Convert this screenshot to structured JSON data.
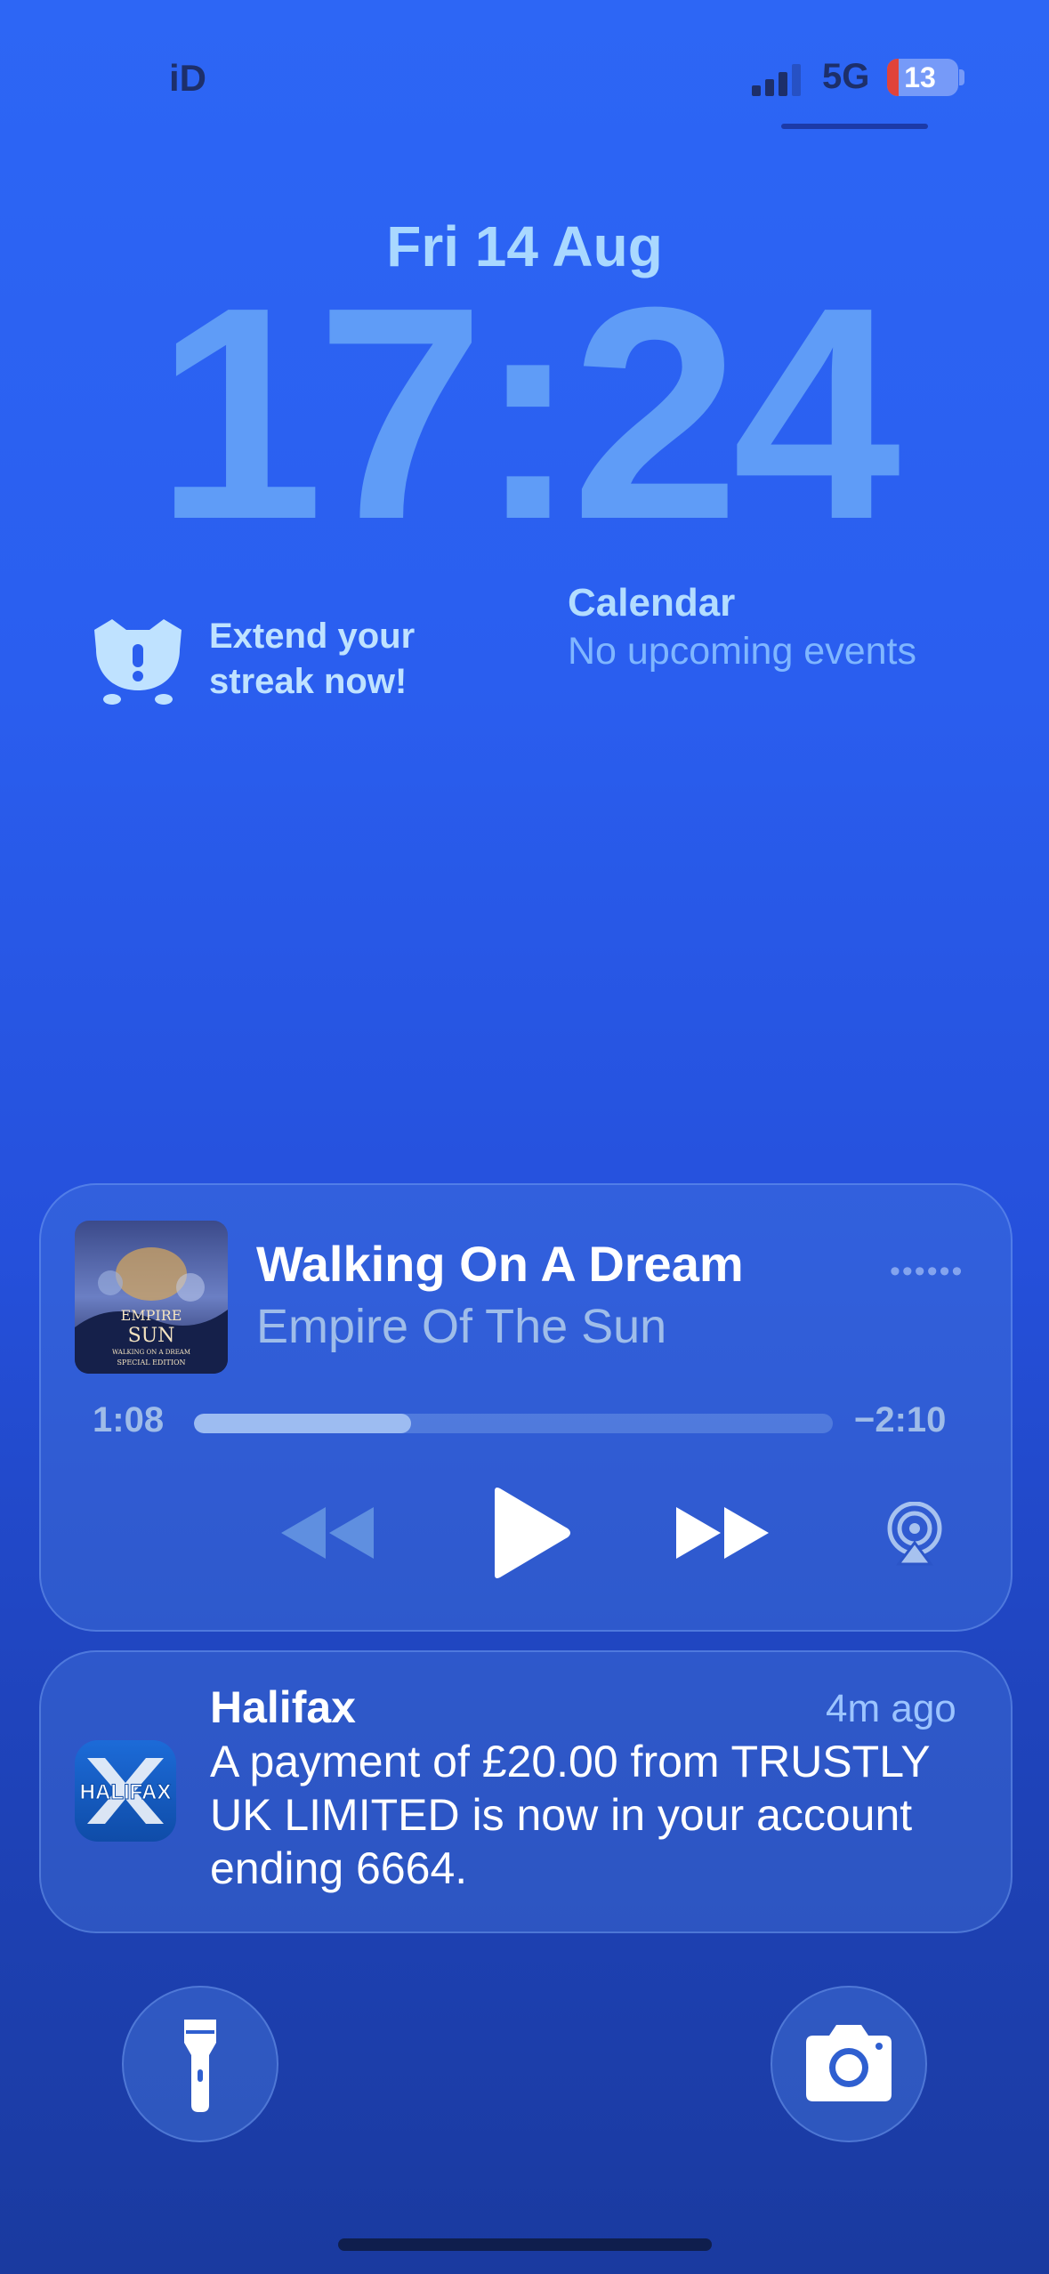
{
  "status_bar": {
    "carrier": "iD",
    "network": "5G",
    "battery_level": "13",
    "signal_icon": "signal-bars-icon"
  },
  "lock_screen": {
    "date": "Fri 14 Aug",
    "time": "17:24"
  },
  "widgets": {
    "streak": {
      "icon": "duolingo-owl-icon",
      "line1": "Extend your",
      "line2": "streak now!"
    },
    "calendar": {
      "title": "Calendar",
      "subtitle": "No upcoming events"
    }
  },
  "now_playing": {
    "song": "Walking On A Dream",
    "artist": "Empire Of The Sun",
    "elapsed": "1:08",
    "remaining": "−2:10",
    "progress_fraction": 0.34,
    "album_art_text": {
      "line1": "EMPIRE",
      "line2": "SUN",
      "line3": "WALKING ON A DREAM",
      "line4": "SPECIAL EDITION"
    },
    "controls": [
      "rewind-icon",
      "play-icon",
      "fast-forward-icon",
      "airplay-icon"
    ]
  },
  "notification": {
    "app": "Halifax",
    "logo_text": "HALIFAX",
    "time": "4m ago",
    "body": "A payment of £20.00 from TRUSTLY UK LIMITED is now in your account ending 6664."
  },
  "quick_actions": {
    "left": "flashlight-icon",
    "right": "camera-icon"
  },
  "colors": {
    "background_top": "#2d66f5",
    "background_bottom": "#1a3a9f",
    "clock": "#5f9cf7",
    "date": "#a9d8ff",
    "battery_low": "#e0433a"
  }
}
